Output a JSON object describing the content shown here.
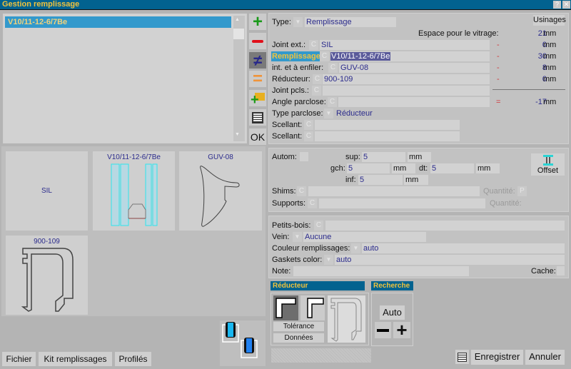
{
  "window": {
    "title": "Gestion remplissage",
    "help": "?",
    "close": "✕"
  },
  "list": {
    "items": [
      "V10/11-12-6/7Be"
    ]
  },
  "side_buttons": {
    "ok": "OK"
  },
  "tiles": [
    "SIL",
    "V10/11-12-6/7Be",
    "GUV-08",
    "900-109"
  ],
  "footer_left": {
    "fichier": "Fichier",
    "kit": "Kit remplissages",
    "profiles": "Profilés"
  },
  "form": {
    "usinages": "Usinages",
    "type": {
      "label": "Type:",
      "value": "Remplissage"
    },
    "espace": {
      "label": "Espace pour le vitrage:",
      "value": "21",
      "unit": "mm"
    },
    "rows": [
      {
        "label": "Joint ext.:",
        "c": "C",
        "value": "SIL",
        "op": "-",
        "num": "0",
        "unit": "mm"
      },
      {
        "label": "Remplissage:",
        "c": "C",
        "value": "V10/11-12-6/7Be",
        "op": "-",
        "num": "30",
        "unit": "mm"
      },
      {
        "label": "int. et à enfiler:",
        "c": "C",
        "value": "GUV-08",
        "op": "-",
        "num": "8",
        "unit": "mm"
      },
      {
        "label": "Réducteur:",
        "c": "C",
        "value": "900-109",
        "op": "-",
        "num": "0",
        "unit": "mm"
      },
      {
        "label": "Joint pcls.:",
        "c": "C",
        "value": ""
      },
      {
        "label": "Angle parclose:",
        "c": "C",
        "value": "",
        "op": "=",
        "num": "-17",
        "unit": "mm"
      }
    ],
    "type_parclose": {
      "label": "Type parclose:",
      "value": "Réducteur"
    },
    "scellant1": {
      "label": "Scellant:",
      "c": "C",
      "value": ""
    },
    "scellant2": {
      "label": "Scellant:",
      "c": "C",
      "value": ""
    }
  },
  "offsets": {
    "autom": "Autom:",
    "sup": {
      "label": "sup:",
      "value": "5",
      "unit": "mm"
    },
    "gch": {
      "label": "gch:",
      "value": "5",
      "unit": "mm"
    },
    "dt": {
      "label": "dt:",
      "value": "5",
      "unit": "mm"
    },
    "inf": {
      "label": "inf:",
      "value": "5",
      "unit": "mm"
    },
    "offset_button": "Offset",
    "shims": {
      "label": "Shims:",
      "c": "C",
      "qty_label": "Quantité:",
      "qty_btn": "P"
    },
    "supports": {
      "label": "Supports:",
      "c": "C",
      "qty_label": "Quantité:"
    }
  },
  "extra": {
    "petits_bois": {
      "label": "Petits-bois:",
      "c": "C",
      "value": ""
    },
    "vein": {
      "label": "Vein:",
      "value": "Aucune"
    },
    "couleur": {
      "label": "Couleur remplissages:",
      "value": "auto"
    },
    "gaskets": {
      "label": "Gaskets color:",
      "value": "auto"
    },
    "note": {
      "label": "Note:",
      "value": ""
    },
    "cache": {
      "label": "Cache:"
    }
  },
  "reducteur": {
    "title": "Réducteur",
    "tolerance": "Tolérance",
    "donnees": "Données"
  },
  "recherche": {
    "title": "Recherche",
    "auto": "Auto"
  },
  "footer_right": {
    "save": "Enregistrer",
    "cancel": "Annuler"
  },
  "colors": {
    "titlebar": "#02628f",
    "title_text": "#f2c23c",
    "selection": "#3399cc",
    "value_text": "#2b2b8c"
  }
}
